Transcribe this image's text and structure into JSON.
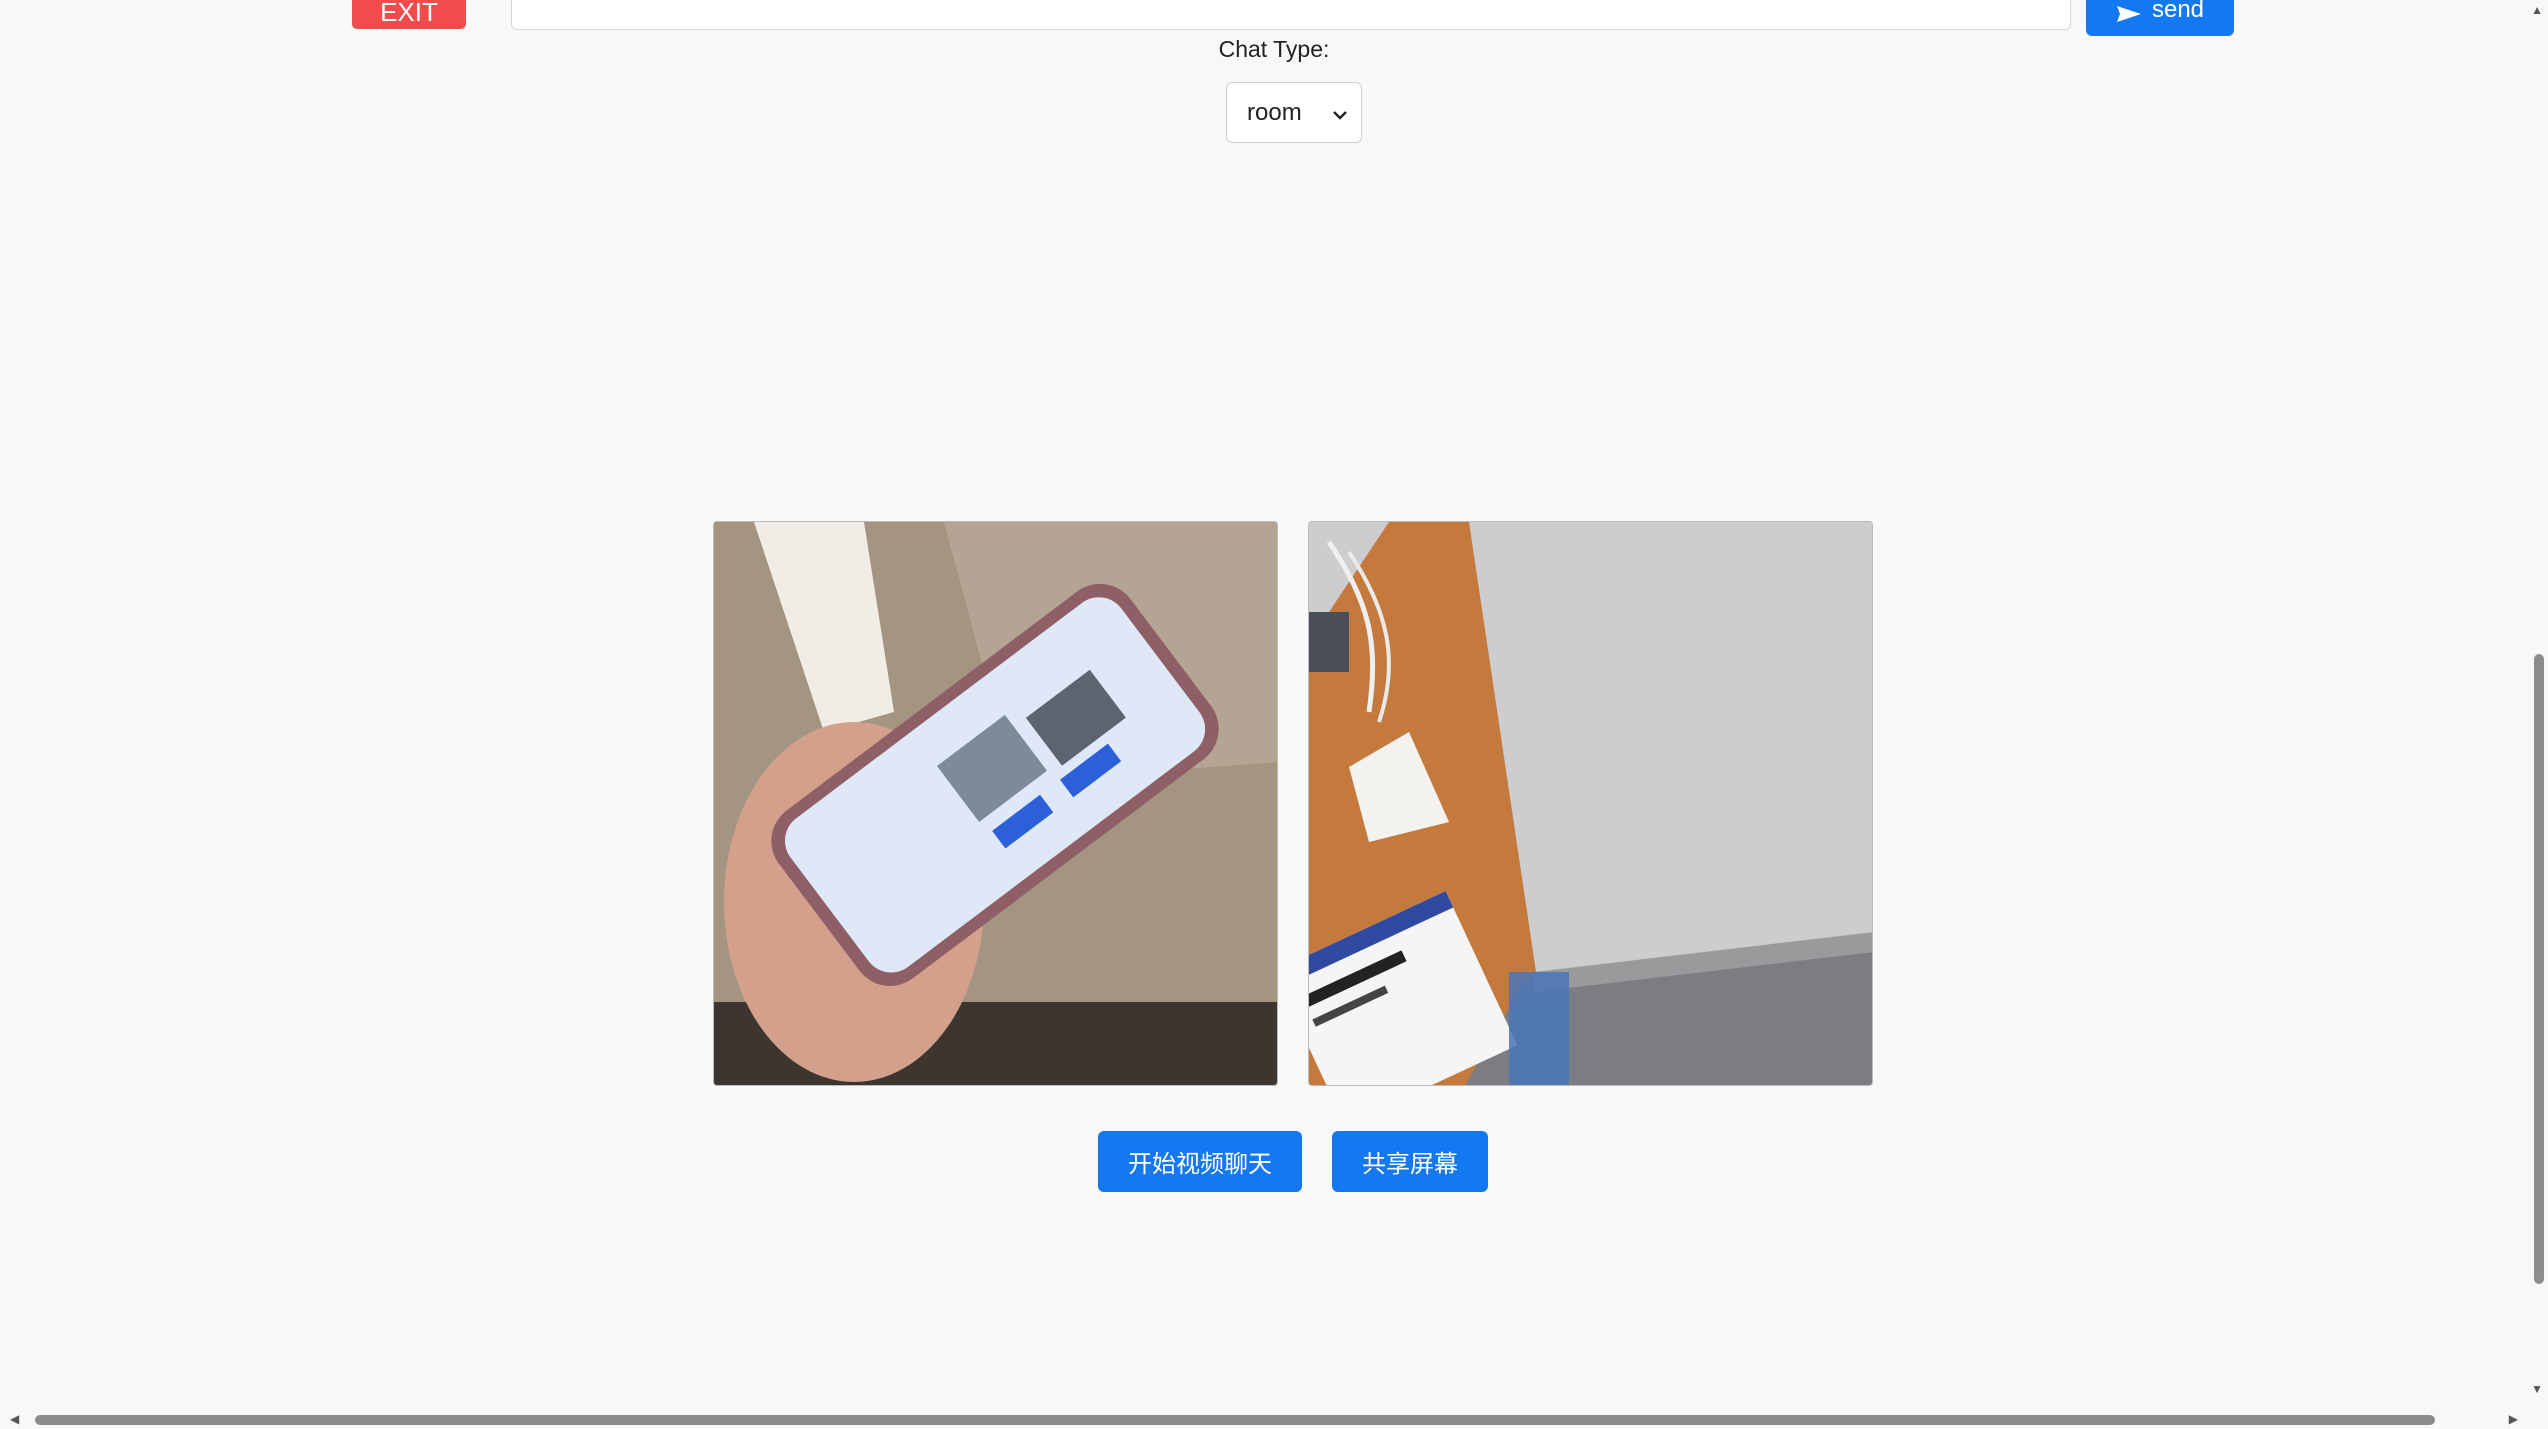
{
  "header": {
    "exit_label": "EXIT",
    "message_value": "",
    "send_label": "send"
  },
  "chat_type": {
    "label": "Chat Type:",
    "selected": "room"
  },
  "controls": {
    "start_video_label": "开始视频聊天",
    "share_screen_label": "共享屏幕"
  },
  "colors": {
    "exit": "#f04c4c",
    "primary": "#1478f0"
  }
}
